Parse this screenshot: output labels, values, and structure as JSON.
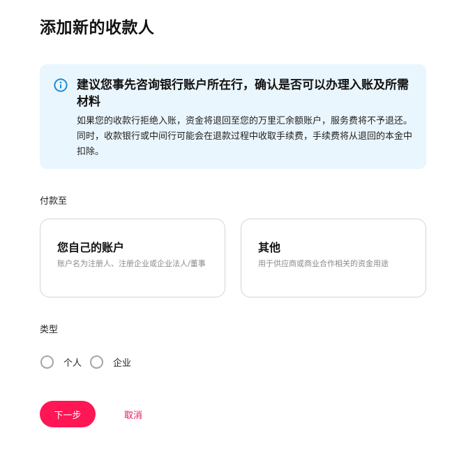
{
  "page": {
    "title": "添加新的收款人"
  },
  "notice": {
    "icon": "info-icon",
    "title": "建议您事先咨询银行账户所在行，确认是否可以办理入账及所需材料",
    "body": "如果您的收款行拒绝入账，资金将退回至您的万里汇余额账户，服务费将不予退还。同时，收款银行或中间行可能会在退款过程中收取手续费，手续费将从退回的本金中扣除。",
    "bg_color": "#eaf6fd",
    "icon_color": "#1a8ad8"
  },
  "pay_to": {
    "label": "付款至",
    "options": [
      {
        "title": "您自己的账户",
        "description": "账户名为注册人、注册企业或企业法人/董事"
      },
      {
        "title": "其他",
        "description": "用于供应商或商业合作相关的资金用途"
      }
    ]
  },
  "type": {
    "label": "类型",
    "options": [
      {
        "label": "个人",
        "selected": false
      },
      {
        "label": "企业",
        "selected": false
      }
    ]
  },
  "actions": {
    "next_label": "下一步",
    "cancel_label": "取消",
    "primary_color": "#ff1655"
  }
}
